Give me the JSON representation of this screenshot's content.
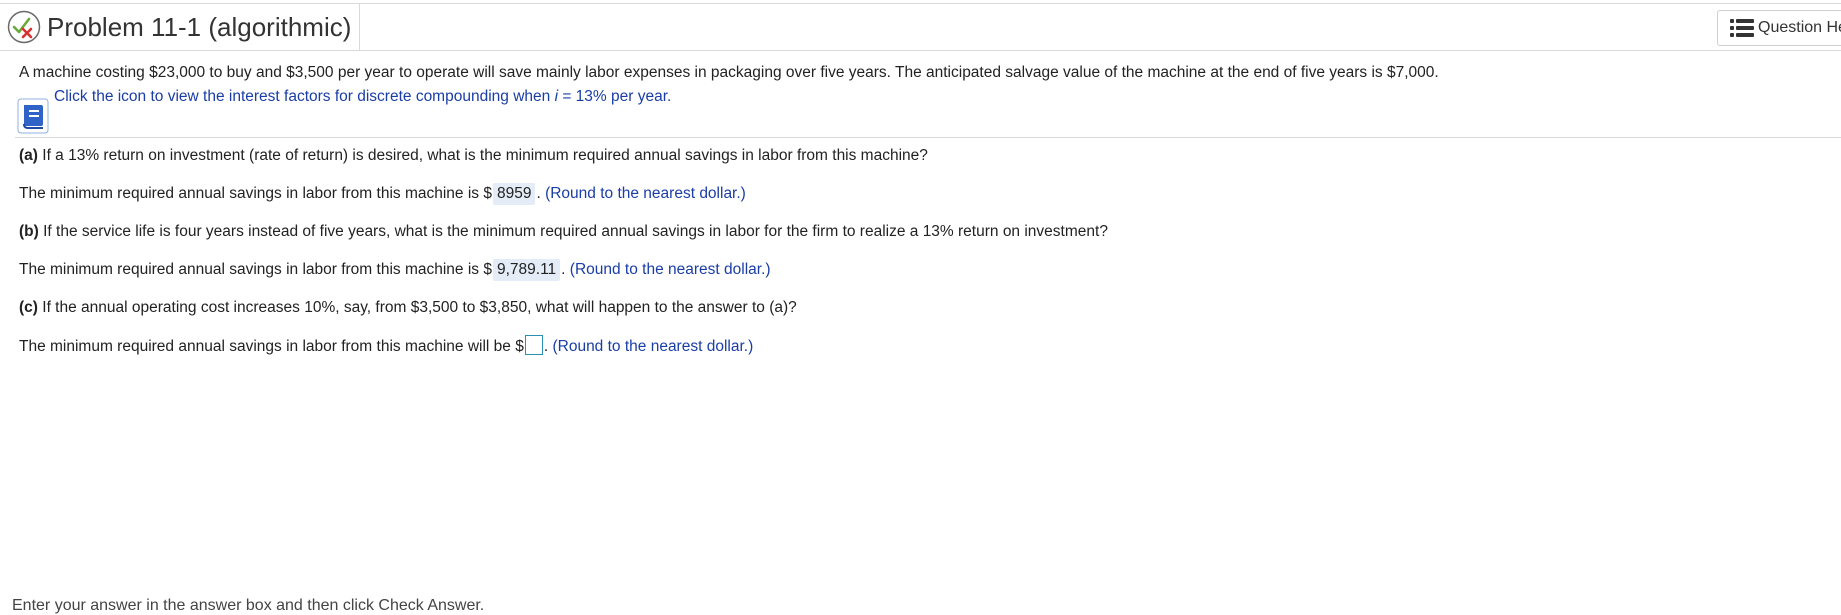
{
  "header": {
    "title": "Problem 11-1 (algorithmic)",
    "status_icon": "partial-correct-check-x-icon",
    "help_button_label": "Question Hel",
    "help_icon": "list-icon"
  },
  "problem": {
    "statement": "A machine costing $23,000 to buy and $3,500 per year to operate will save mainly labor expenses in packaging over five years. The anticipated salvage value of the machine at the end of five years is $7,000.",
    "link_prefix": "Click the icon to view the interest factors for discrete compounding when ",
    "link_var": "i",
    "link_suffix": " = 13% per year.",
    "link_icon": "book-icon"
  },
  "parts": {
    "a": {
      "label": "(a)",
      "question": " If a 13% return on investment (rate of return) is desired, what is the minimum required annual savings in labor from this machine?",
      "answer_prefix": "The minimum required annual savings in labor from this machine is $",
      "answer_value": "8959",
      "answer_suffix": ". ",
      "hint": "(Round to the nearest dollar.)"
    },
    "b": {
      "label": "(b)",
      "question": " If the service life is four years instead of five years, what is the minimum required annual savings in labor for the firm to realize a 13% return on investment?",
      "answer_prefix": "The minimum required annual savings in labor from this machine is $",
      "answer_value": "9,789.11",
      "answer_suffix": ". ",
      "hint": "(Round to the nearest dollar.)"
    },
    "c": {
      "label": "(c)",
      "question": " If the annual operating cost increases 10%, say, from $3,500 to $3,850, what will happen to the answer to (a)?",
      "answer_prefix": "The minimum required annual savings in labor from this machine will be $",
      "answer_value": "",
      "answer_suffix": ". ",
      "hint": "(Round to the nearest dollar.)"
    }
  },
  "footer": {
    "instruction": "Enter your answer in the answer box and then click Check Answer."
  },
  "colors": {
    "link_blue": "#1a3da6",
    "answer_bg": "#e4ecf7",
    "input_border": "#2a8fb5",
    "divider": "#d9d9d9"
  }
}
